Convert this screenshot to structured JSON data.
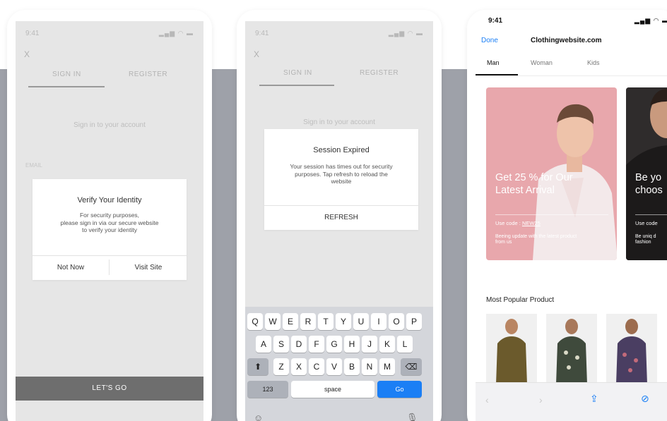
{
  "login_screen": {
    "status_time": "9:41",
    "status_icons": "signal-wifi-battery",
    "close_label": "X",
    "tabs": [
      "SIGN IN",
      "REGISTER"
    ],
    "subtitle": "Sign in to your account",
    "email_label": "EMAIL",
    "dialog": {
      "title": "Verify Your Identity",
      "body": "For security purposes,\nplease sign in via our secure website\nto verify your identity",
      "btn_secondary": "Not Now",
      "btn_primary": "Visit Site"
    },
    "cta_label": "LET'S GO"
  },
  "session_screen": {
    "status_time": "9:41",
    "status_icons": "signal-wifi-battery",
    "close_label": "X",
    "tabs": [
      "SIGN IN",
      "REGISTER"
    ],
    "subtitle": "Sign in to your account",
    "dialog": {
      "title": "Session Expired",
      "body": "Your session has times out for security\npurposes. Tap refresh to reload the\nwebsite",
      "button": "REFRESH"
    },
    "keyboard": {
      "row1": [
        "Q",
        "W",
        "E",
        "R",
        "T",
        "Y",
        "U",
        "I",
        "O",
        "P"
      ],
      "row2": [
        "A",
        "S",
        "D",
        "F",
        "G",
        "H",
        "J",
        "K",
        "L"
      ],
      "row3": [
        "Z",
        "X",
        "C",
        "V",
        "B",
        "N",
        "M"
      ],
      "numbers_key": "123",
      "space_key": "space",
      "go_key": "Go",
      "shift_icon": "shift-icon",
      "delete_icon": "backspace-icon",
      "emoji_icon": "emoji-icon",
      "mic_icon": "microphone-icon"
    }
  },
  "shop_screen": {
    "status_time": "9:41",
    "status_icons": "signal-wifi-battery",
    "done_label": "Done",
    "url": "Clothingwebsite.com",
    "categories": [
      "Man",
      "Woman",
      "Kids"
    ],
    "active_category": "Man",
    "promo_1": {
      "headline": "Get 25 % for Our\nLatest Arrival",
      "code_prefix": "Use code : ",
      "code": "NEW25",
      "note": "Beeing update with the latest product\nfrom us"
    },
    "promo_2": {
      "headline": "Be yo\nchoos",
      "code_prefix": "Use code",
      "note": "Be uniq d\nfashion"
    },
    "section_title": "Most Popular Product",
    "toolbar_icons": [
      "back-icon",
      "forward-icon",
      "share-icon",
      "compass-icon"
    ],
    "colors": {
      "accent_blue": "#1b7ff5",
      "promo_pink": "#e8a7ac",
      "backdrop_gray": "#9ea1a9"
    }
  }
}
